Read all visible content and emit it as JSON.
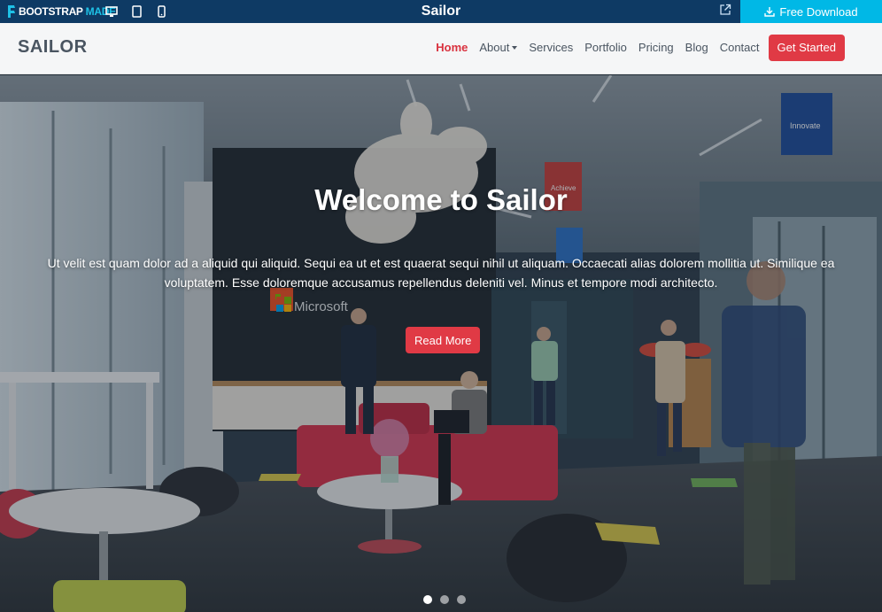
{
  "topbar": {
    "brand_part1": "BOOTSTRAP",
    "brand_part2": "MADE",
    "title": "Sailor",
    "download_label": "Free Download",
    "devices": [
      "desktop-icon",
      "tablet-icon",
      "mobile-icon"
    ]
  },
  "navbar": {
    "logo": "SAILOR",
    "items": [
      {
        "label": "Home",
        "active": true
      },
      {
        "label": "About",
        "dropdown": true
      },
      {
        "label": "Services"
      },
      {
        "label": "Portfolio"
      },
      {
        "label": "Pricing"
      },
      {
        "label": "Blog"
      },
      {
        "label": "Contact"
      }
    ],
    "cta": "Get Started"
  },
  "hero": {
    "title": "Welcome to Sailor",
    "text": "Ut velit est quam dolor ad a aliquid qui aliquid. Sequi ea ut et est quaerat sequi nihil ut aliquam. Occaecati alias dolorem mollitia ut. Similique ea voluptatem. Esse doloremque accusamus repellendus deleniti vel. Minus et tempore modi architecto.",
    "button": "Read More",
    "wall_sign": "Microsoft",
    "banner_1": "Achieve",
    "banner_2": "Innovate",
    "slides": 3,
    "active_slide": 1
  },
  "colors": {
    "topbar": "#0e3a64",
    "download": "#00b8e6",
    "accent": "#e03a45"
  }
}
